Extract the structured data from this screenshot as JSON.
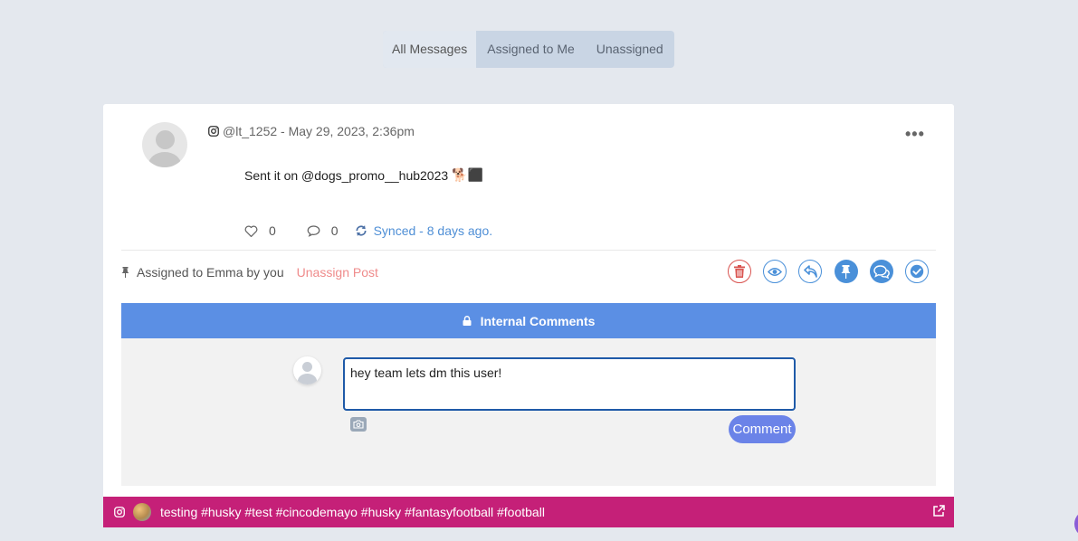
{
  "tabs": [
    {
      "label": "All Messages",
      "active": true
    },
    {
      "label": "Assigned to Me",
      "active": false
    },
    {
      "label": "Unassigned",
      "active": false
    }
  ],
  "post": {
    "handle_time": "@lt_1252 - May 29, 2023, 2:36pm",
    "message": "Sent it on  @dogs_promo__hub2023",
    "emoji": "🐕‍⬛",
    "likes": "0",
    "comments": "0",
    "synced": "Synced - 8 days ago.",
    "more_label": "•••"
  },
  "assignment": {
    "label": "Assigned to Emma by you",
    "unassign": "Unassign Post"
  },
  "actions": [
    {
      "name": "delete",
      "icon": "trash-icon"
    },
    {
      "name": "view",
      "icon": "eye-icon"
    },
    {
      "name": "reply",
      "icon": "reply-icon"
    },
    {
      "name": "pin",
      "icon": "pin-icon"
    },
    {
      "name": "internal-comments",
      "icon": "chat-bubbles-icon"
    },
    {
      "name": "complete",
      "icon": "check-icon"
    }
  ],
  "internal_comments": {
    "title": "Internal Comments",
    "input_value": "hey team lets dm this user!",
    "button_label": "Comment"
  },
  "footer": {
    "tags": "testing #husky #test #cincodemayo #husky #fantasyfootball #football"
  },
  "colors": {
    "accent": "#4a90d9",
    "header": "#5b8fe4",
    "danger": "#d9534f",
    "instagram": "#c52078",
    "comment_button": "#6b83e8"
  }
}
